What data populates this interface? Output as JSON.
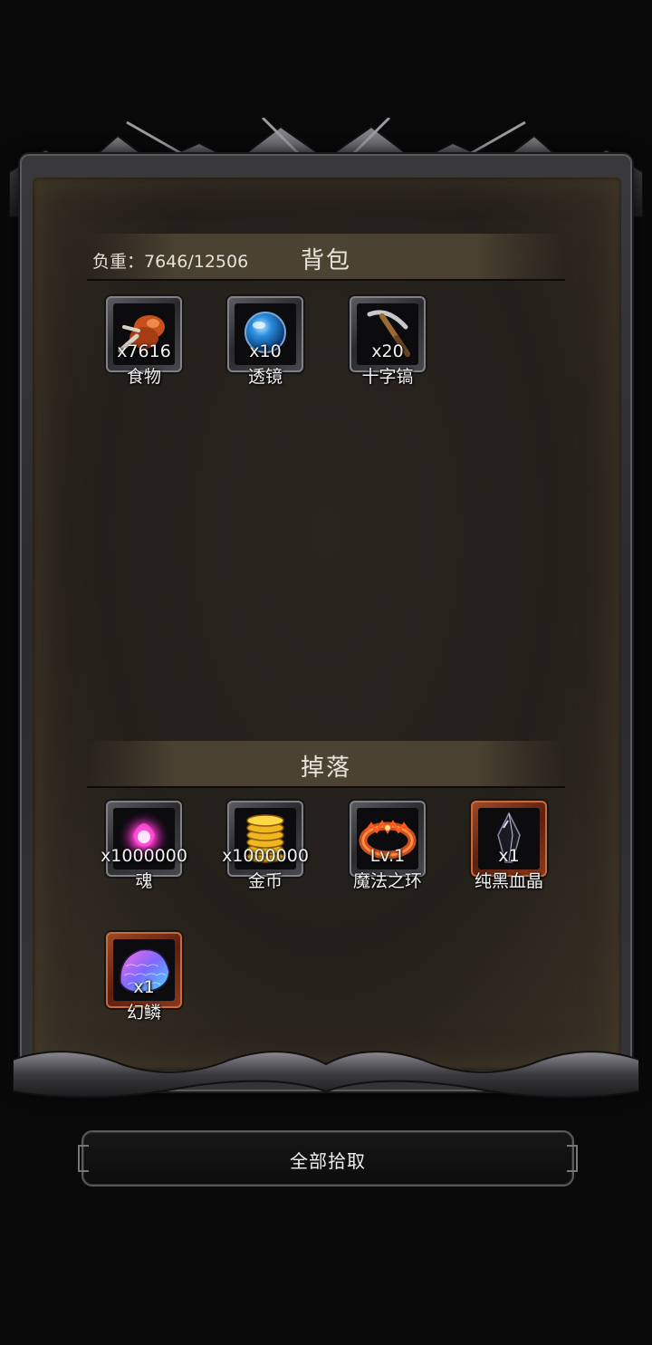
{
  "backpack": {
    "title": "背包",
    "weight_text": "负重：7646/12506",
    "items": [
      {
        "name": "食物",
        "count": "x7616",
        "icon": "food-icon"
      },
      {
        "name": "透镜",
        "count": "x10",
        "icon": "lens-icon"
      },
      {
        "name": "十字镐",
        "count": "x20",
        "icon": "pickaxe-icon"
      }
    ]
  },
  "drops": {
    "title": "掉落",
    "items": [
      {
        "name": "魂",
        "count": "x1000000",
        "icon": "soul-icon",
        "rarity": "normal"
      },
      {
        "name": "金币",
        "count": "x1000000",
        "icon": "gold-coin-icon",
        "rarity": "normal"
      },
      {
        "name": "魔法之环",
        "count": "Lv.1",
        "icon": "magic-ring-icon",
        "rarity": "normal"
      },
      {
        "name": "纯黑血晶",
        "count": "x1",
        "icon": "black-blood-crystal-icon",
        "rarity": "rare"
      },
      {
        "name": "幻鳞",
        "count": "x1",
        "icon": "phantom-scale-icon",
        "rarity": "rare"
      }
    ]
  },
  "actions": {
    "pickup_all": "全部拾取"
  },
  "colors": {
    "rare_border": "#a34a28",
    "text": "#f2f2f2",
    "panel": "#231f1a"
  }
}
